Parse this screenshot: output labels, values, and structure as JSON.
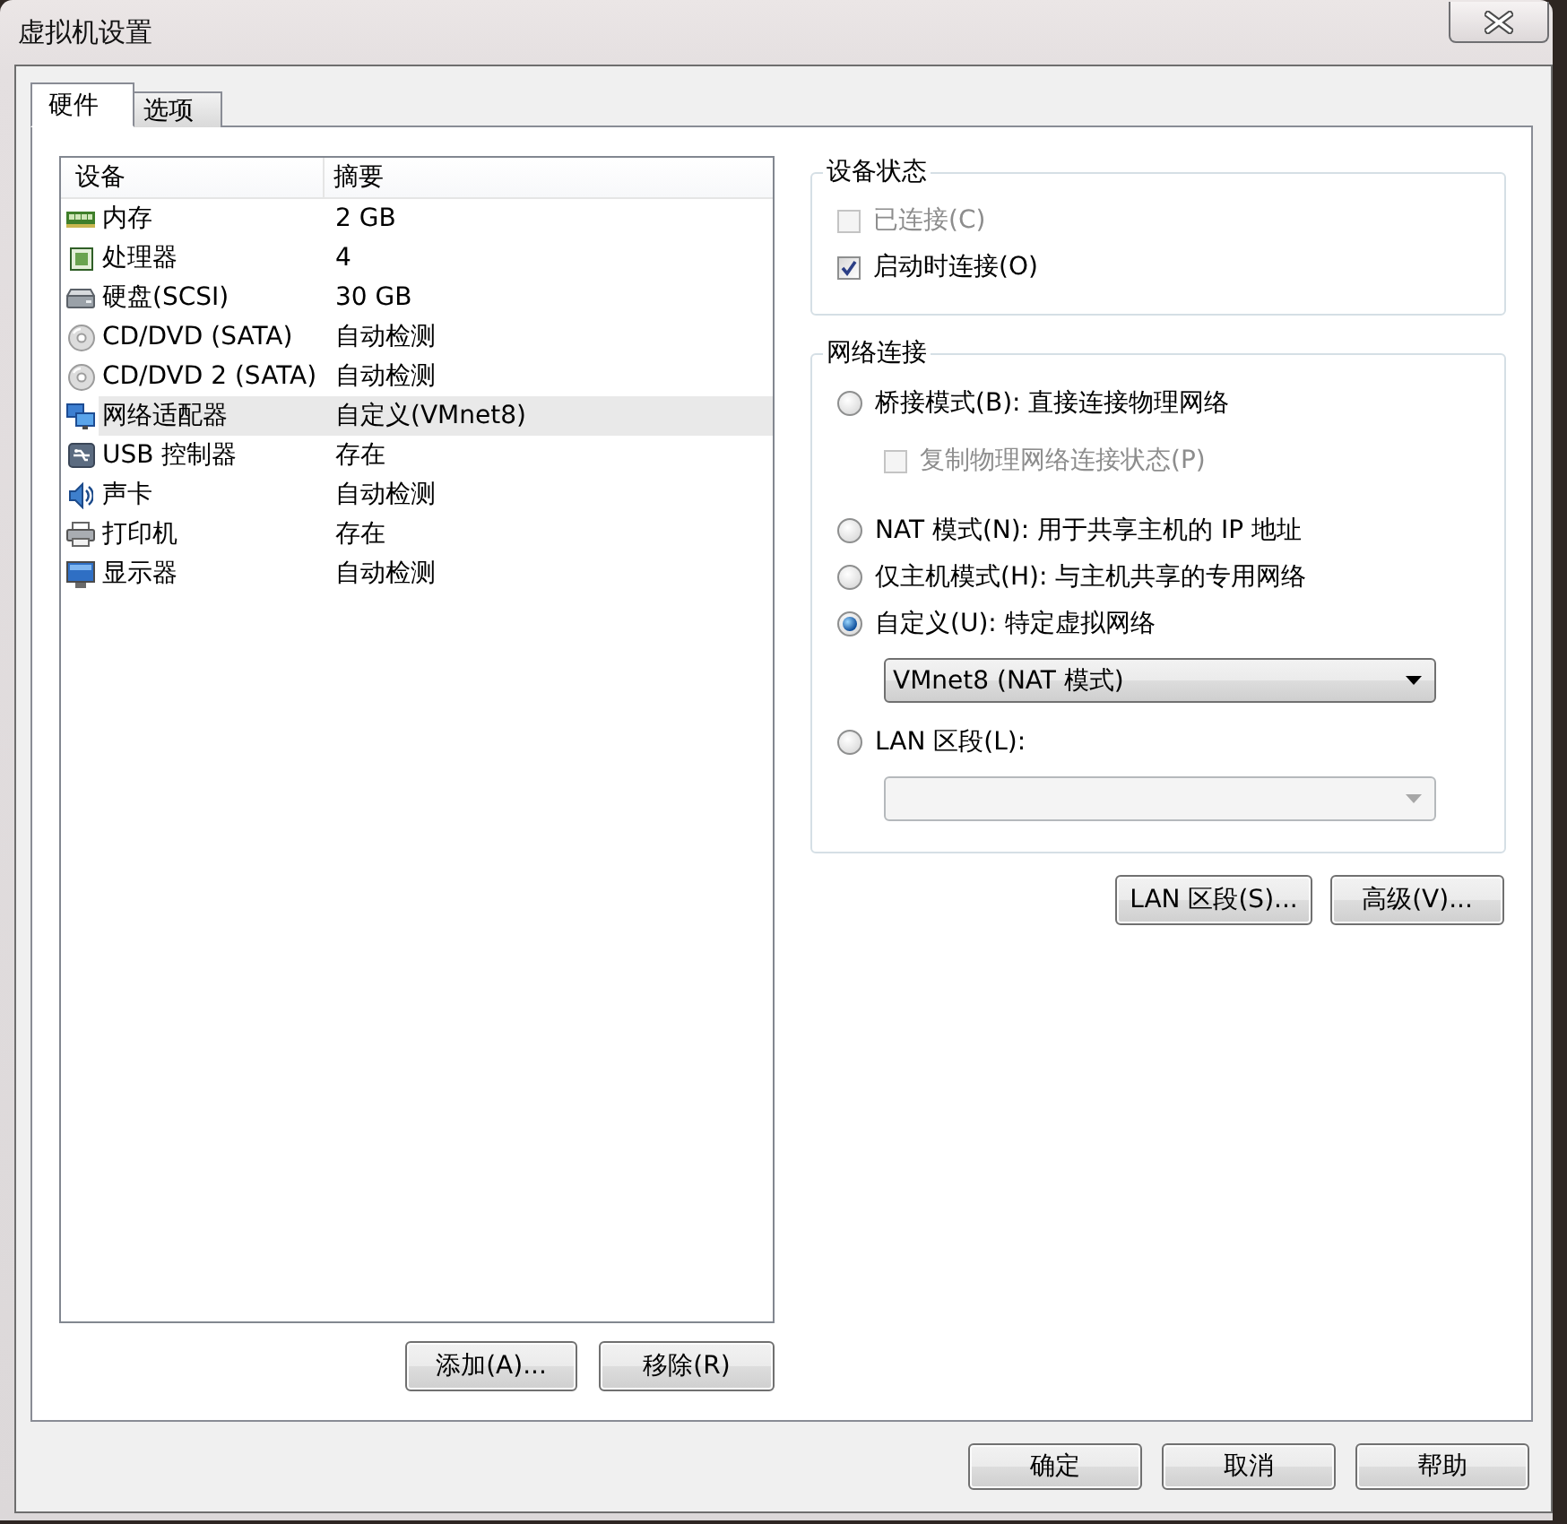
{
  "window": {
    "title": "虚拟机设置"
  },
  "tabs": [
    {
      "label": "硬件",
      "selected": true
    },
    {
      "label": "选项",
      "selected": false
    }
  ],
  "device_list": {
    "columns": [
      "设备",
      "摘要"
    ],
    "rows": [
      {
        "kind": "memory",
        "device": "内存",
        "summary": "2 GB",
        "selected": false
      },
      {
        "kind": "processor",
        "device": "处理器",
        "summary": "4",
        "selected": false
      },
      {
        "kind": "disk",
        "device": "硬盘(SCSI)",
        "summary": "30 GB",
        "selected": false
      },
      {
        "kind": "cdrom",
        "device": "CD/DVD (SATA)",
        "summary": "自动检测",
        "selected": false
      },
      {
        "kind": "cdrom",
        "device": "CD/DVD 2 (SATA)",
        "summary": "自动检测",
        "selected": false
      },
      {
        "kind": "network",
        "device": "网络适配器",
        "summary": "自定义(VMnet8)",
        "selected": true
      },
      {
        "kind": "usb",
        "device": "USB 控制器",
        "summary": "存在",
        "selected": false
      },
      {
        "kind": "sound",
        "device": "声卡",
        "summary": "自动检测",
        "selected": false
      },
      {
        "kind": "printer",
        "device": "打印机",
        "summary": "存在",
        "selected": false
      },
      {
        "kind": "display",
        "device": "显示器",
        "summary": "自动检测",
        "selected": false
      }
    ]
  },
  "list_buttons": [
    "添加(A)...",
    "移除(R)"
  ],
  "device_status": {
    "title": "设备状态",
    "options": [
      {
        "label": "已连接(C)",
        "checked": false,
        "disabled": true
      },
      {
        "label": "启动时连接(O)",
        "checked": true,
        "disabled": false
      }
    ]
  },
  "network_connection": {
    "title": "网络连接",
    "options": [
      {
        "label": "桥接模式(B): 直接连接物理网络",
        "selected": false,
        "children": [
          {
            "kind": "checkbox",
            "label": "复制物理网络连接状态(P)",
            "checked": false,
            "disabled": true
          }
        ]
      },
      {
        "label": "NAT 模式(N): 用于共享主机的 IP 地址",
        "selected": false
      },
      {
        "label": "仅主机模式(H): 与主机共享的专用网络",
        "selected": false
      },
      {
        "label": "自定义(U): 特定虚拟网络",
        "selected": true,
        "children": [
          {
            "kind": "dropdown",
            "value": "VMnet8 (NAT 模式)",
            "disabled": false
          }
        ]
      },
      {
        "label": "LAN 区段(L):",
        "selected": false,
        "children": [
          {
            "kind": "dropdown",
            "disabled": true
          }
        ]
      }
    ]
  },
  "network_buttons": [
    "LAN 区段(S)...",
    "高级(V)..."
  ],
  "dialog_buttons": [
    "确定",
    "取消",
    "帮助"
  ]
}
